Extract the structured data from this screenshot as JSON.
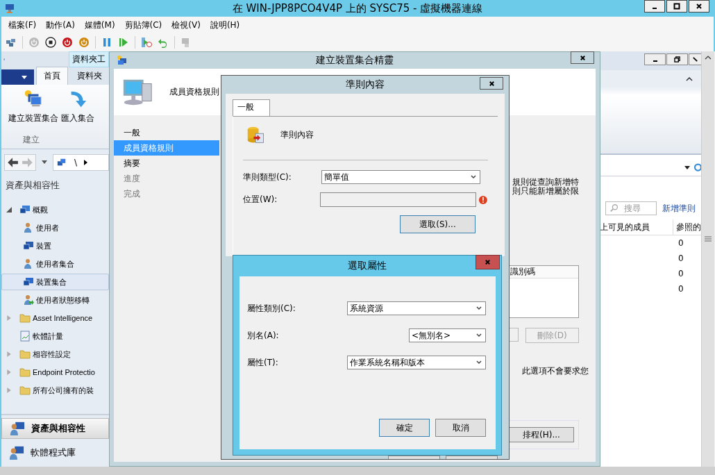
{
  "vm_window": {
    "title": "在 WIN-JPP8PCO4V4P 上的 SYSC75 - 虛擬機器連線",
    "menu": [
      "檔案(F)",
      "動作(A)",
      "媒體(M)",
      "剪貼簿(C)",
      "檢視(V)",
      "說明(H)"
    ]
  },
  "console": {
    "context_tab": "資料夾工",
    "ribbon_tabs": [
      {
        "label": "首頁",
        "selected": true
      },
      {
        "label": "資料夾",
        "selected": false
      }
    ],
    "ribbon_buttons": [
      {
        "label": "建立裝置集合",
        "kind": "new-collection"
      },
      {
        "label": "匯入集合",
        "kind": "import"
      }
    ],
    "ribbon_group": "建立",
    "address_path": "\\",
    "nav_title": "資產與相容性",
    "tree": [
      {
        "label": "概觀",
        "kind": "overview",
        "expandable": true,
        "expanded": true,
        "selected": false,
        "children": [
          {
            "label": "使用者",
            "kind": "user",
            "selected": false
          },
          {
            "label": "裝置",
            "kind": "device",
            "selected": false
          },
          {
            "label": "使用者集合",
            "kind": "user-collection",
            "selected": false
          },
          {
            "label": "裝置集合",
            "kind": "device-collection",
            "selected": true
          },
          {
            "label": "使用者狀態移轉",
            "kind": "migration",
            "selected": false
          }
        ]
      },
      {
        "label": "Asset Intelligence",
        "kind": "folder",
        "expandable": true,
        "expanded": false,
        "selected": false
      },
      {
        "label": "軟體計量",
        "kind": "metering",
        "expandable": false,
        "selected": false
      },
      {
        "label": "相容性設定",
        "kind": "folder",
        "expandable": true,
        "expanded": false,
        "selected": false
      },
      {
        "label": "Endpoint Protectio",
        "kind": "folder",
        "expandable": true,
        "expanded": false,
        "selected": false
      },
      {
        "label": "所有公司擁有的裝",
        "kind": "folder",
        "expandable": true,
        "expanded": false,
        "selected": false
      }
    ],
    "workspaces": [
      {
        "label": "資產與相容性",
        "selected": true
      },
      {
        "label": "軟體程式庫",
        "selected": false
      }
    ],
    "search": {
      "placeholder": "搜尋"
    },
    "add_criteria_link": "新增準則",
    "table": {
      "columns": [
        "上可見的成員",
        "參照的"
      ],
      "rows": [
        {
          "column_2": "0"
        },
        {
          "column_2": "0"
        },
        {
          "column_2": "0"
        },
        {
          "column_2": "0"
        }
      ]
    }
  },
  "wizard": {
    "title": "建立裝置集合精靈",
    "header": "成員資格規則",
    "steps": [
      {
        "label": "一般",
        "selected": false,
        "disabled": false
      },
      {
        "label": "成員資格規則",
        "selected": true,
        "disabled": false
      },
      {
        "label": "摘要",
        "selected": false,
        "disabled": false
      },
      {
        "label": "進度",
        "selected": false,
        "disabled": true
      },
      {
        "label": "完成",
        "selected": false,
        "disabled": true
      }
    ],
    "description_lines": [
      "規則從查詢新增特",
      "則只能新增屬於限"
    ],
    "list_header": "識別碼",
    "delete_button": {
      "label": "刪除(D)",
      "disabled": true
    },
    "note": "此選項不會要求您",
    "schedule_button": "排程(H)..."
  },
  "rule_dialog": {
    "title": "準則內容",
    "tab": "一般",
    "heading": "準則內容",
    "criteria_type": {
      "label": "準則類型(C):",
      "value": "簡單值"
    },
    "location": {
      "label": "位置(W):",
      "error": true
    },
    "select_button": "選取(S)..."
  },
  "select_dialog": {
    "title": "選取屬性",
    "fields": [
      {
        "label": "屬性類別(C):",
        "value": "系統資源",
        "kind": "wide"
      },
      {
        "label": "別名(A):",
        "value": "<無別名>",
        "kind": "narrow"
      },
      {
        "label": "屬性(T):",
        "value": "作業系統名稱和版本",
        "kind": "wide"
      }
    ],
    "buttons": [
      {
        "label": "確定",
        "default": true
      },
      {
        "label": "取消",
        "default": false
      }
    ]
  }
}
